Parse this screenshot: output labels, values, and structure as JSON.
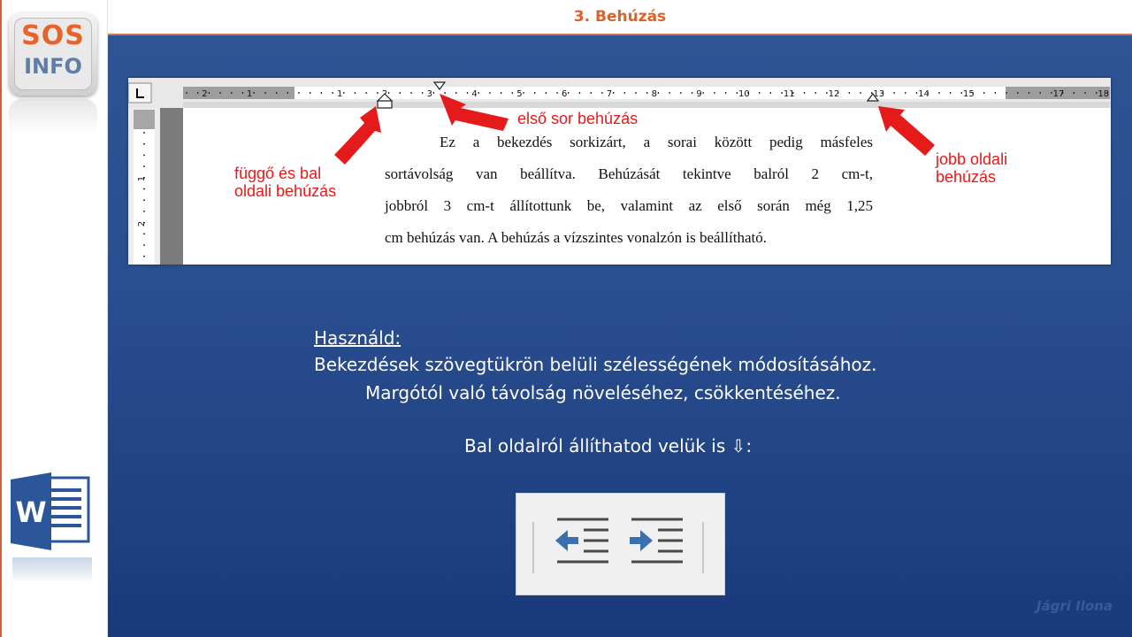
{
  "header": {
    "title": "3. Behúzás"
  },
  "logo": {
    "line1": "SOS",
    "line2": "INFO"
  },
  "app_icon": {
    "name": "word-icon",
    "letter": "W"
  },
  "screenshot": {
    "ruler": {
      "left_numbers": [
        "2",
        "1"
      ],
      "right_numbers": [
        "1",
        "2",
        "3",
        "4",
        "5",
        "6",
        "7",
        "8",
        "9",
        "10",
        "11",
        "12",
        "13",
        "14",
        "15",
        "17",
        "18"
      ],
      "vertical_numbers": [
        "1",
        "2"
      ]
    },
    "labels": {
      "first_line": "első sor behúzás",
      "hanging_left_1": "függő és bal",
      "hanging_left_2": "oldali behúzás",
      "right_1": "jobb oldali",
      "right_2": "behúzás"
    },
    "paragraph": [
      "Ez a bekezdés sorkizárt, a sorai között pedig másfeles",
      "sortávolság van beállítva. Behúzását tekintve balról 2 cm-t,",
      "jobbról 3 cm-t állítottunk be, valamint az első során még 1,25",
      "cm behúzás van. A behúzás a vízszintes vonalzón is beállítható."
    ],
    "colors": {
      "arrow": "#e51a1a",
      "label": "#e51a1a"
    }
  },
  "instructions": {
    "heading": "Használd:",
    "line1": "Bekezdések szövegtükrön belüli szélességének módosításához.",
    "line2": "Margótól való távolság növeléséhez, csökkentéséhez.",
    "hint": "Bal oldalról állíthatod velük is ⇩:"
  },
  "indent_buttons": [
    "decrease-indent",
    "increase-indent"
  ],
  "author": "Jágri Ilona",
  "colors": {
    "accent": "#e0602a",
    "background": "#2a4f90",
    "icon_blue": "#3a6fb0"
  }
}
